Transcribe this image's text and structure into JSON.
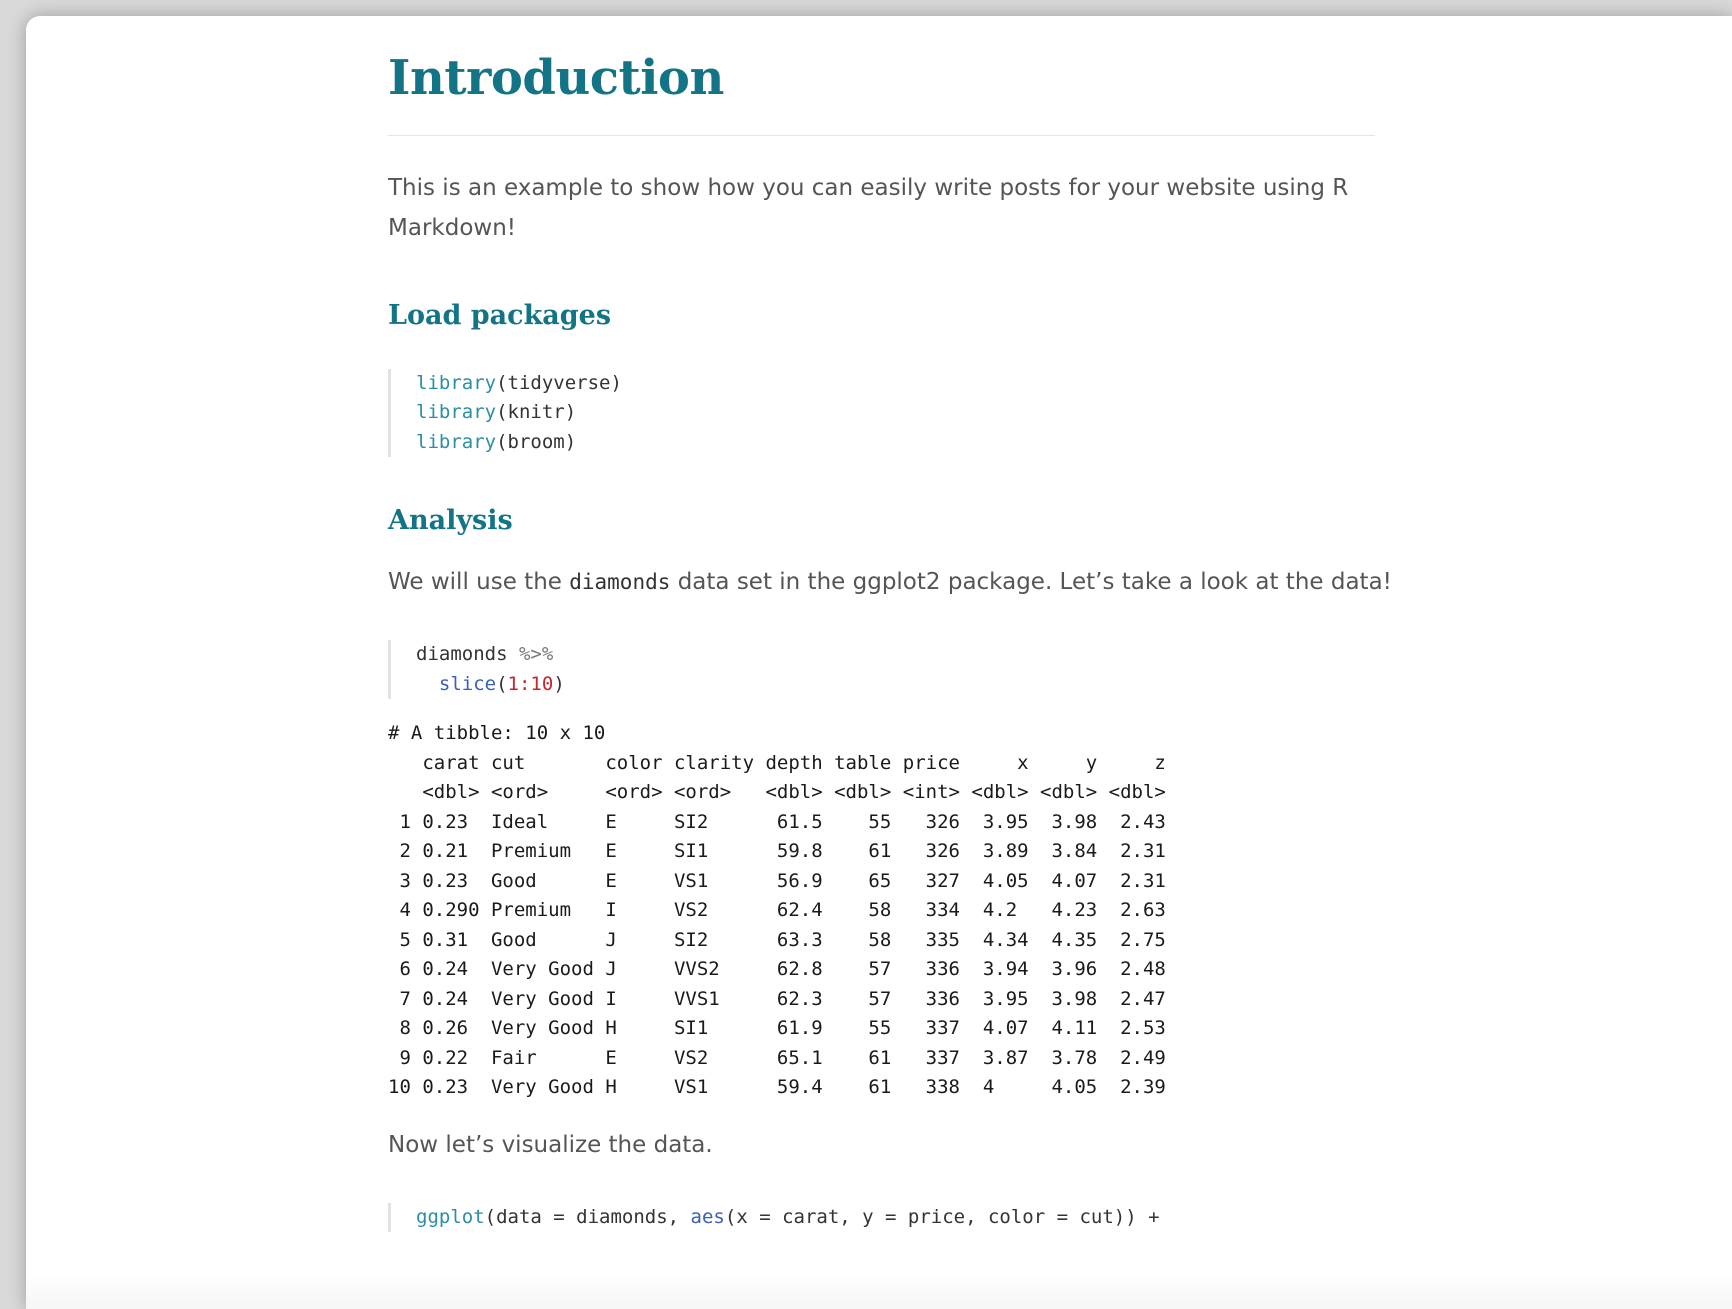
{
  "article": {
    "title": "Introduction",
    "intro_text": "This is an example to show how you can easily write posts for your website using R Markdown!",
    "load_packages_heading": "Load packages",
    "analysis_heading": "Analysis",
    "analysis_text_before": "We will use the ",
    "analysis_text_code": "diamonds",
    "analysis_text_after": " data set in the ggplot2 package. Let’s take a look at the data!",
    "visualize_text": "Now let’s visualize the data."
  },
  "code_blocks": {
    "packages": [
      {
        "fn": "library",
        "open": "(",
        "arg": "tidyverse",
        "close": ")"
      },
      {
        "fn": "library",
        "open": "(",
        "arg": "knitr",
        "close": ")"
      },
      {
        "fn": "library",
        "open": "(",
        "arg": "broom",
        "close": ")"
      }
    ],
    "slice": {
      "line1_obj": "diamonds",
      "line1_pipe": " %>%",
      "line2_fn": "slice",
      "line2_open": "(",
      "line2_num": "1:10",
      "line2_close": ")"
    },
    "ggplot": {
      "fn": "ggplot",
      "open": "(data = diamonds, ",
      "aes_fn": "aes",
      "rest": "(x = carat, y = price, color = cut)) +"
    }
  },
  "tibble_output": {
    "header_line": "# A tibble: 10 x 10",
    "columns_line": "   carat cut       color clarity depth table price     x     y     z",
    "types_line": "   <dbl> <ord>     <ord> <ord>   <dbl> <dbl> <int> <dbl> <dbl> <dbl>",
    "rows": [
      " 1 0.23  Ideal     E     SI2      61.5    55   326  3.95  3.98  2.43",
      " 2 0.21  Premium   E     SI1      59.8    61   326  3.89  3.84  2.31",
      " 3 0.23  Good      E     VS1      56.9    65   327  4.05  4.07  2.31",
      " 4 0.290 Premium   I     VS2      62.4    58   334  4.2   4.23  2.63",
      " 5 0.31  Good      J     SI2      63.3    58   335  4.34  4.35  2.75",
      " 6 0.24  Very Good J     VVS2     62.8    57   336  3.94  3.96  2.48",
      " 7 0.24  Very Good I     VVS1     62.3    57   336  3.95  3.98  2.47",
      " 8 0.26  Very Good H     SI1      61.9    55   337  4.07  4.11  2.53",
      " 9 0.22  Fair      E     VS2      65.1    61   337  3.87  3.78  2.49",
      "10 0.23  Very Good H     VS1      59.4    61   338  4     4.05  2.39"
    ]
  },
  "colors": {
    "heading": "#137485",
    "body_text": "#555555",
    "code_function": "#2b8ea3",
    "code_number": "#c4262f"
  }
}
